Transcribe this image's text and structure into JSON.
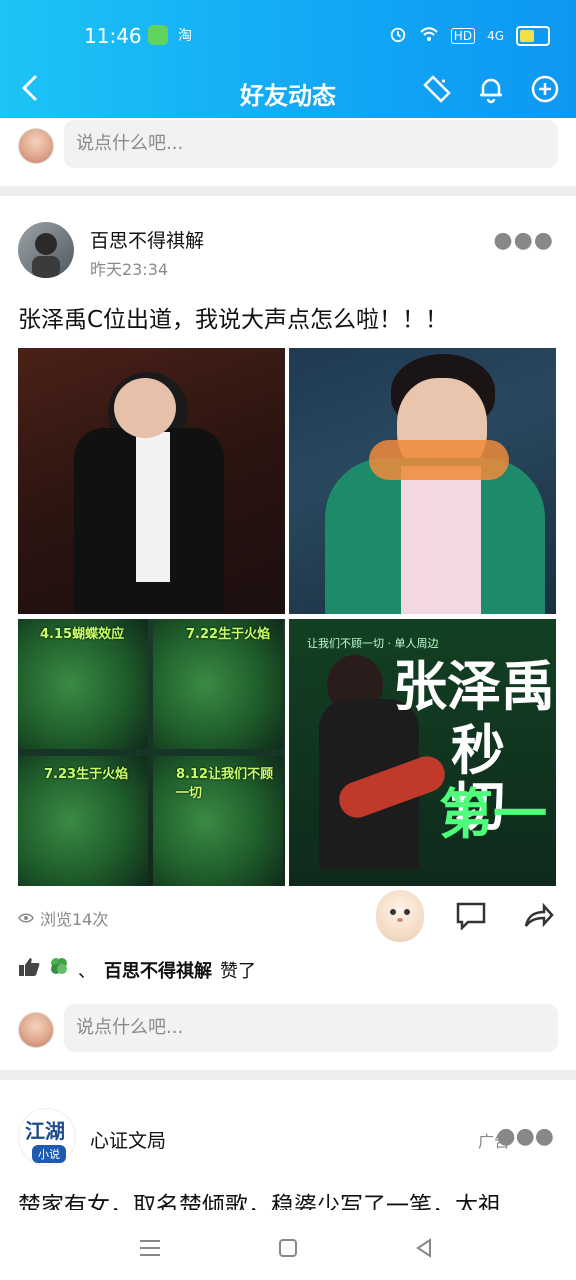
{
  "status_bar": {
    "time": "11:46",
    "app_label": "淘",
    "hd_label": "HD",
    "network_label": "4G"
  },
  "header": {
    "title": "好友动态"
  },
  "top_comment": {
    "placeholder": "说点什么吧..."
  },
  "post": {
    "author": "百思不得祺解",
    "time": "昨天23:34",
    "text": "张泽禹C位出道，我说大声点怎么啦！！！",
    "photo3_tags": [
      "4.15蝴蝶效应",
      "7.22生于火焰",
      "7.23生于火焰",
      "8.12让我们不顾一切"
    ],
    "photo4_texts": {
      "small": "让我们不顾一切 · 单人周边",
      "line1": "张泽禹",
      "line2": "秒切",
      "line3": "第一"
    },
    "views": "浏览14次",
    "likes_separator": "、",
    "likes_name": "百思不得祺解",
    "likes_suffix": "赞了"
  },
  "post_comment": {
    "placeholder": "说点什么吧..."
  },
  "ad": {
    "logo_top": "江湖",
    "logo_bottom": "小说",
    "author": "心证文局",
    "tag": "广告",
    "text": "楚家有女，取名楚倾歌，稳婆少写了一笔，太祖"
  },
  "colors": {
    "header_start": "#1cc4f6",
    "header_end": "#0d98f2",
    "divider": "#eeeeee",
    "input_bg": "#f2f2f2"
  }
}
